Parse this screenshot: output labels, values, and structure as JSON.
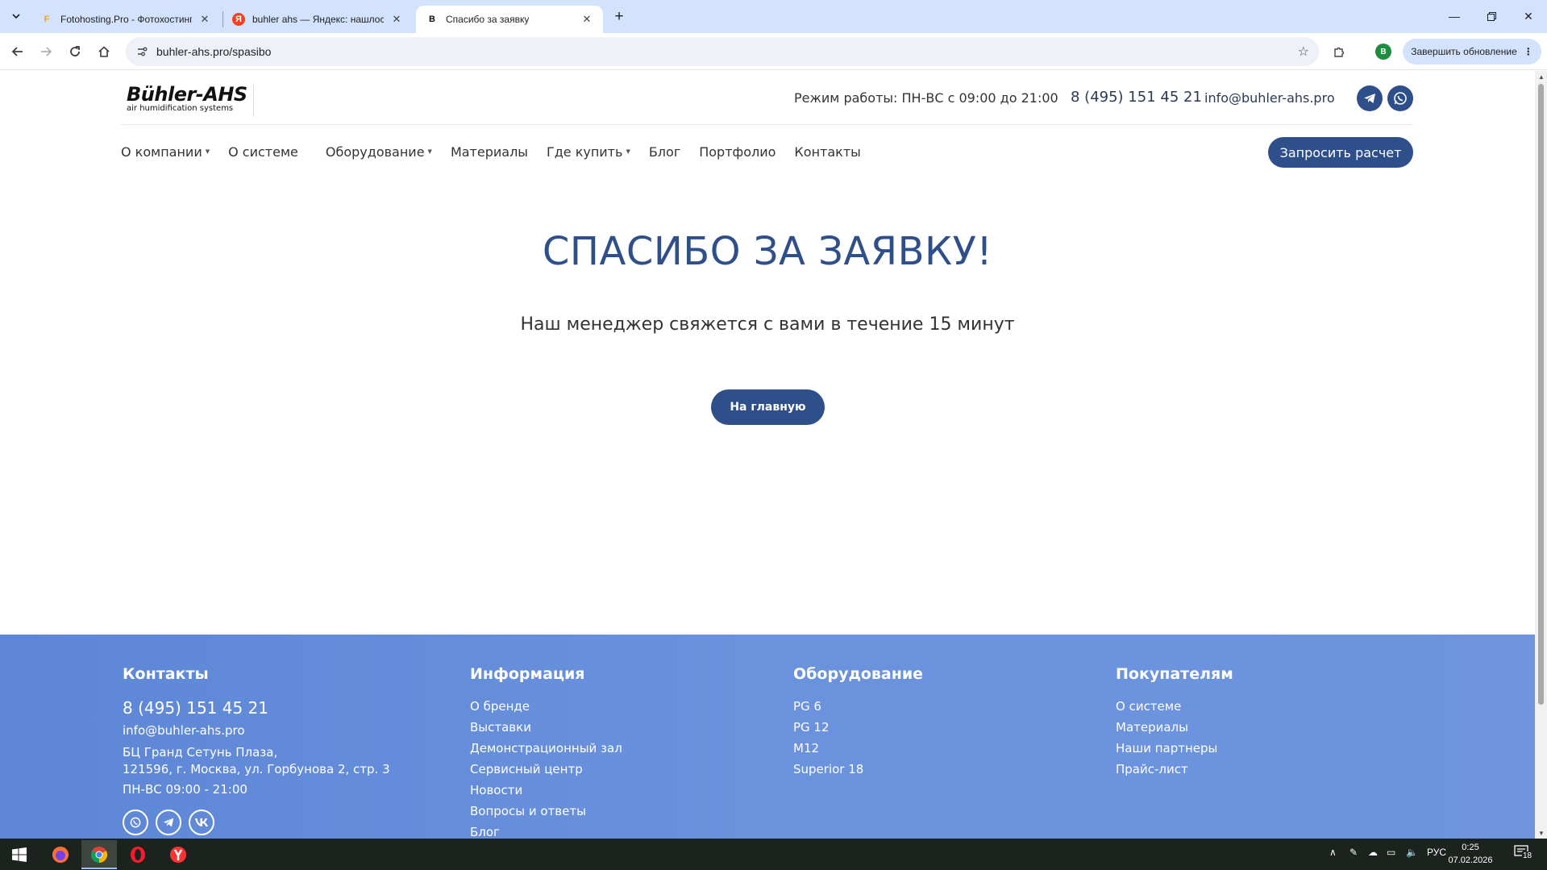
{
  "browser": {
    "tabs": [
      {
        "title": "Fotohosting.Pro - Фотохостинг",
        "favicon": "F",
        "favicon_color": "#e8a23b"
      },
      {
        "title": "buhler ahs — Яндекс: нашлось",
        "favicon": "Я",
        "favicon_color": "#fc3f1d"
      },
      {
        "title": "Спасибо за заявку",
        "favicon": "B",
        "favicon_color": "#111111"
      }
    ],
    "url": "buhler-ahs.pro/spasibo",
    "profile_initial": "B",
    "update_label": "Завершить обновление"
  },
  "header": {
    "logo_name": "Bühler-AHS",
    "logo_tagline": "air humidification systems",
    "hours": "Режим работы: ПН-ВС с 09:00 до 21:00",
    "phone": "8 (495) 151 45 21",
    "email": "info@buhler-ahs.pro"
  },
  "menu": {
    "items": [
      {
        "label": "О компании"
      },
      {
        "label": "О системе"
      },
      {
        "label": "Оборудование"
      },
      {
        "label": "Материалы"
      },
      {
        "label": "Где купить"
      },
      {
        "label": "Блог"
      },
      {
        "label": "Портфолио"
      },
      {
        "label": "Контакты"
      }
    ],
    "cta": "Запросить расчет"
  },
  "hero": {
    "title": "СПАСИБО ЗА ЗАЯВКУ!",
    "subtitle": "Наш менеджер свяжется с вами в течение 15 минут",
    "button": "На главную"
  },
  "footer": {
    "contacts": {
      "heading": "Контакты",
      "phone": "8 (495) 151 45 21",
      "email": "info@buhler-ahs.pro",
      "address1": "БЦ Гранд Сетунь Плаза,",
      "address2": "121596, г. Москва, ул. Горбунова 2, стр. 3",
      "hours": "ПН-ВС 09:00 - 21:00"
    },
    "info": {
      "heading": "Информация",
      "links": [
        "О бренде",
        "Выставки",
        "Демонстрационный зал",
        "Сервисный центр",
        "Новости",
        "Вопросы и ответы",
        "Блог"
      ]
    },
    "equipment": {
      "heading": "Оборудование",
      "links": [
        "PG 6",
        "PG 12",
        "M12",
        "Superior 18"
      ]
    },
    "buyers": {
      "heading": "Покупателям",
      "links": [
        "О системе",
        "Материалы",
        "Наши партнеры",
        "Прайс-лист"
      ]
    }
  },
  "taskbar": {
    "lang": "РУС",
    "time": "0:25",
    "date": "07.02.2026",
    "notifications": "18"
  },
  "colors": {
    "brand": "#2f4f8a",
    "footer": "#6a92dd",
    "tabbar": "#d3e3fd"
  }
}
